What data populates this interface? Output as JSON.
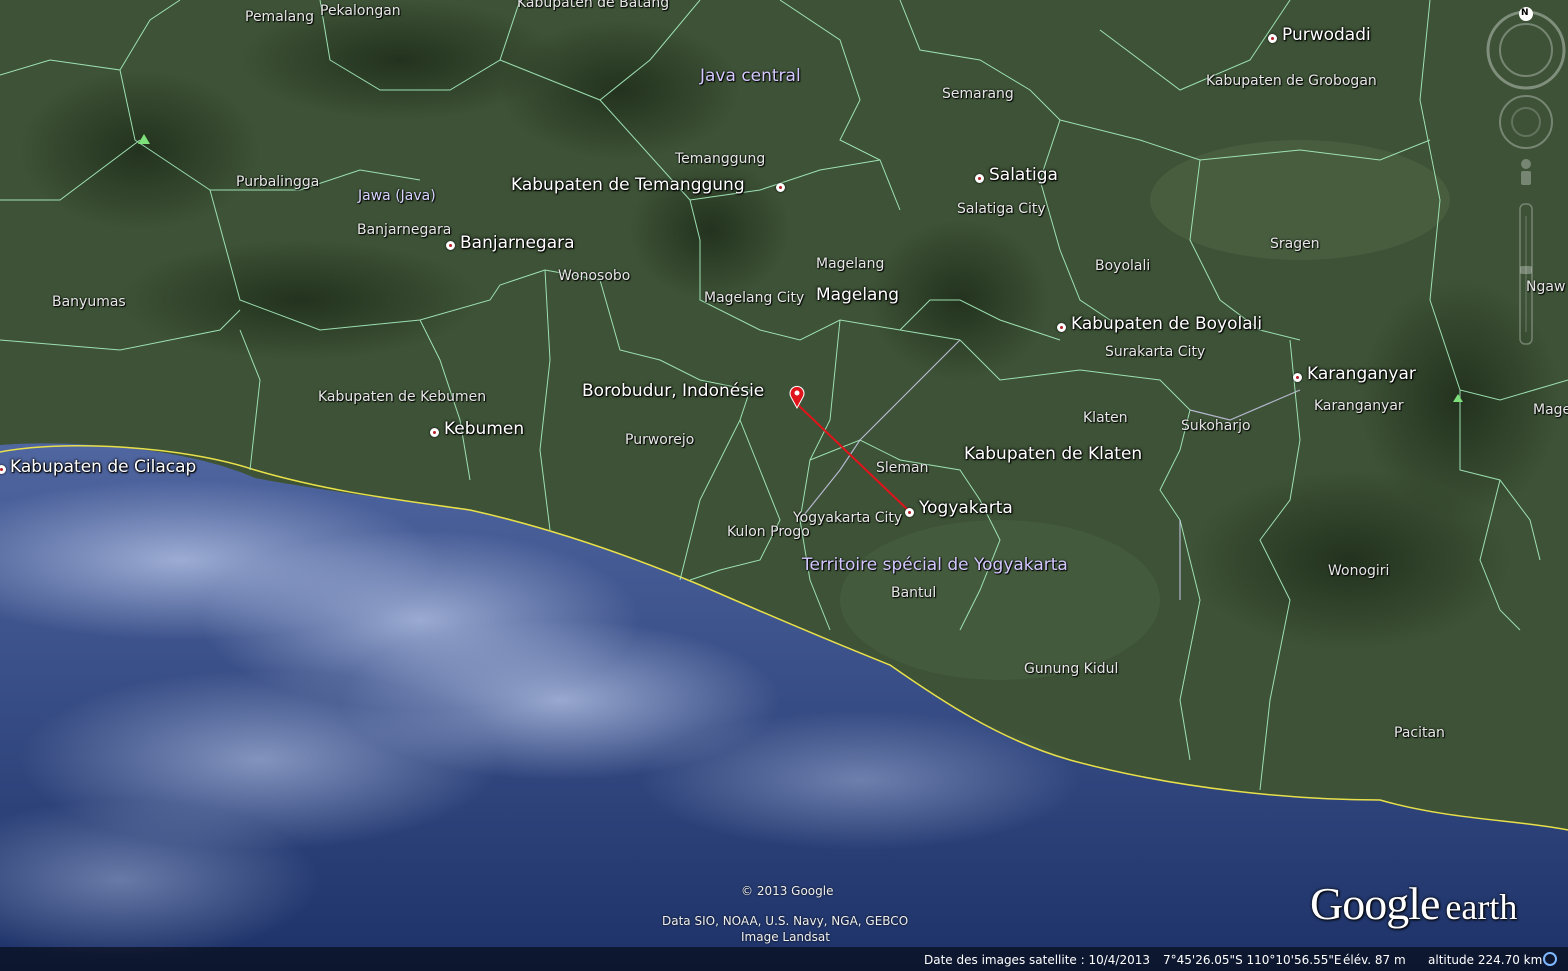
{
  "map": {
    "regions": [
      "Java central",
      "Jawa (Java)",
      "Territoire spécial de Yogyakarta"
    ],
    "cities": [
      "Purwodadi",
      "Salatiga",
      "Kabupaten de Temanggung",
      "Banjarnegara",
      "Magelang",
      "Kabupaten de Boyolali",
      "Karanganyar",
      "Borobudur, Indonésie",
      "Kebumen",
      "Kabupaten de Cilacap",
      "Kabupaten de Klaten",
      "Yogyakarta"
    ],
    "places": [
      "Pemalang",
      "Pekalongan",
      "Kabupaten de Batang",
      "Semarang",
      "Kabupaten de Grobogan",
      "Temanggung",
      "Purbalingga",
      "Salatiga City",
      "Banjarnegara",
      "Sragen",
      "Magelang",
      "Boyolali",
      "Wonosobo",
      "Magelang City",
      "Ngaw",
      "Banyumas",
      "Surakarta City",
      "Kabupaten de Kebumen",
      "Karanganyar",
      "Klaten",
      "Mage",
      "Sukoharjo",
      "Purworejo",
      "Sleman",
      "Yogyakarta City",
      "Kulon Progo",
      "Wonogiri",
      "Bantul",
      "Gunung Kidul",
      "Pacitan"
    ],
    "route_color": "#e0141b",
    "coast_color": "#e8e04a",
    "border_color": "#a8f0c0"
  },
  "attribution": {
    "copyright": "© 2013 Google",
    "data": "Data SIO, NOAA, U.S. Navy, NGA, GEBCO",
    "imagery": "Image Landsat"
  },
  "status": {
    "imagery_date": "Date des images satellite : 10/4/2013",
    "coords": "7°45'26.05\"S  110°10'56.55\"E",
    "elevation": "élév.   87 m",
    "altitude": "altitude  224.70 km"
  },
  "logo": {
    "google": "Google",
    "earth": "earth"
  },
  "nav": {
    "north": "N"
  }
}
